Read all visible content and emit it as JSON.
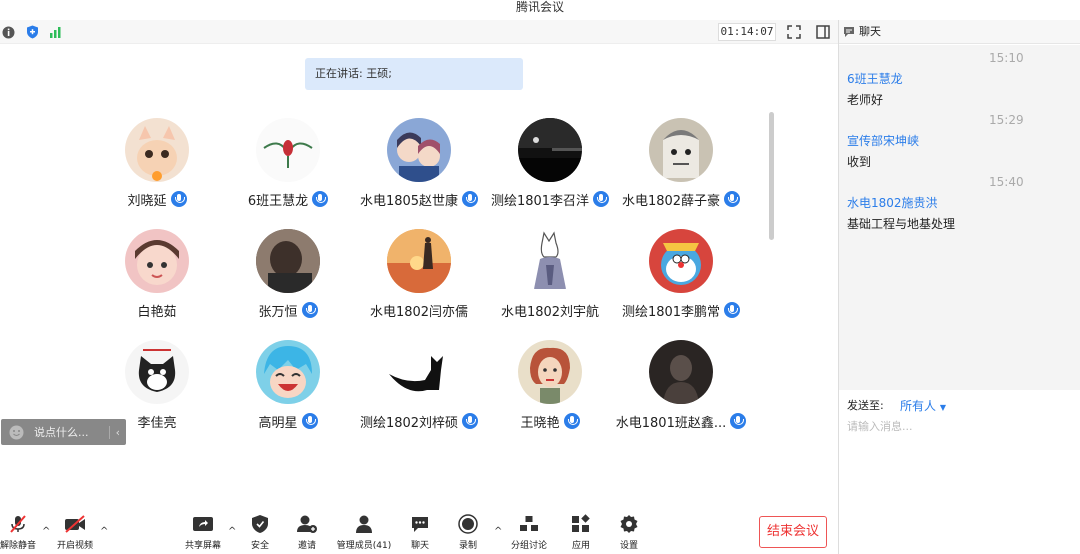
{
  "window": {
    "title": "腾讯会议"
  },
  "topbar": {
    "timer": "01:14:07",
    "signal_color": "#2ebd59",
    "shield_color": "#2b7de9"
  },
  "stage": {
    "speaking_label": "正在讲话: 王硕;"
  },
  "participants": [
    {
      "name": "刘晓延",
      "mic": true,
      "icon": "cat-avatar"
    },
    {
      "name": "6班王慧龙",
      "mic": true,
      "icon": "flower-avatar"
    },
    {
      "name": "水电1805赵世康",
      "mic": true,
      "icon": "anime-avatar"
    },
    {
      "name": "测绘1801李召洋",
      "mic": true,
      "icon": "night-avatar"
    },
    {
      "name": "水电1802薛子豪",
      "mic": true,
      "icon": "cartoon-avatar"
    },
    {
      "name": "白艳茹",
      "mic": false,
      "icon": "child-avatar"
    },
    {
      "name": "张万恒",
      "mic": true,
      "icon": "person-avatar"
    },
    {
      "name": "水电1802闫亦儒",
      "mic": false,
      "icon": "sunset-avatar"
    },
    {
      "name": "水电1802刘宇航",
      "mic": false,
      "icon": "cat-sketch-avatar"
    },
    {
      "name": "测绘1801李鹏常",
      "mic": true,
      "icon": "doraemon-avatar"
    },
    {
      "name": "李佳亮",
      "mic": false,
      "icon": "black-cat-avatar"
    },
    {
      "name": "高明星",
      "mic": true,
      "icon": "laughing-avatar"
    },
    {
      "name": "测绘1802刘梓硕",
      "mic": true,
      "icon": "silhouette-cat-avatar"
    },
    {
      "name": "王晓艳",
      "mic": true,
      "icon": "woman-avatar"
    },
    {
      "name": "水电1801班赵鑫...",
      "mic": true,
      "icon": "shadow-avatar"
    }
  ],
  "float_input": {
    "placeholder": "说点什么..."
  },
  "toolbar": {
    "unmute": "解除静音",
    "video": "开启视频",
    "share": "共享屏幕",
    "security": "安全",
    "invite": "邀请",
    "members": "管理成员(41)",
    "chat": "聊天",
    "record": "录制",
    "breakout": "分组讨论",
    "apps": "应用",
    "settings": "设置",
    "end": "结束会议"
  },
  "chat": {
    "title": "聊天",
    "messages": [
      {
        "time": "15:10",
        "sender": "6班王慧龙",
        "text": "老师好"
      },
      {
        "time": "15:29",
        "sender": "宣传部宋坤峡",
        "text": "收到"
      },
      {
        "time": "15:40",
        "sender": "水电1802施贵洪",
        "text": "基础工程与地基处理"
      }
    ],
    "send_to_label": "发送至:",
    "send_to_value": "所有人",
    "input_placeholder": "请输入消息..."
  }
}
